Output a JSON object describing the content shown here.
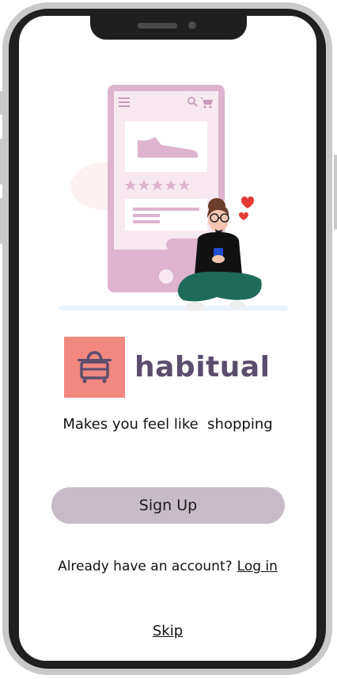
{
  "app": {
    "brand_name": "habitual",
    "tagline": "Makes you feel like  shopping"
  },
  "actions": {
    "signup_label": "Sign Up",
    "login_prompt": "Already have an account?",
    "login_label": "Log in",
    "skip_label": "Skip"
  },
  "colors": {
    "brand_logo_bg": "#f28880",
    "brand_text": "#5b4d6e",
    "signup_button_bg": "#c8bbc8",
    "illustration_phone": "#deb3cd"
  },
  "icons": {
    "logo": "shopping-bag-icon",
    "menu": "menu-icon",
    "search": "search-icon",
    "cart": "cart-icon",
    "shoe": "shoe-icon",
    "stars": "star-icon",
    "hearts": "heart-icon"
  }
}
